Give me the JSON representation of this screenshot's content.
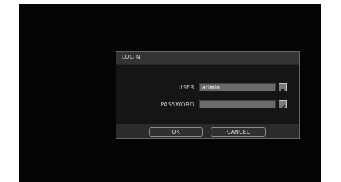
{
  "dialog": {
    "title": "LOGIN",
    "user_label": "USER",
    "user_value": "admin",
    "password_label": "PASSWORD",
    "password_value": "",
    "ok_label": "OK",
    "cancel_label": "CANCEL"
  },
  "icons": {
    "user_keyboard": "eject-keyboard-icon",
    "password_keyboard": "pencil-keyboard-icon"
  },
  "colors": {
    "background": "#040404",
    "dialog_border": "#5d6975",
    "field": "#6a6a6a"
  }
}
